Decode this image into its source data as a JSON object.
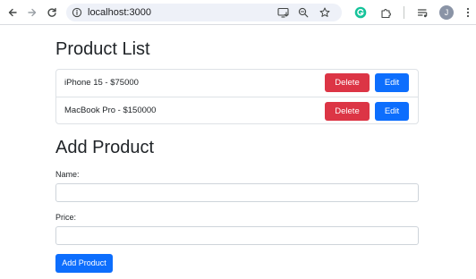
{
  "browser": {
    "url": "localhost:3000",
    "profile_initial": "J"
  },
  "product_list": {
    "title": "Product List",
    "items": [
      {
        "label": "iPhone 15 - $75000",
        "delete_label": "Delete",
        "edit_label": "Edit"
      },
      {
        "label": "MacBook Pro - $150000",
        "delete_label": "Delete",
        "edit_label": "Edit"
      }
    ]
  },
  "add_product": {
    "title": "Add Product",
    "name_label": "Name:",
    "name_value": "",
    "price_label": "Price:",
    "price_value": "",
    "submit_label": "Add Product"
  },
  "colors": {
    "primary": "#0d6efd",
    "danger": "#dc3545",
    "border": "#dee2e6"
  }
}
